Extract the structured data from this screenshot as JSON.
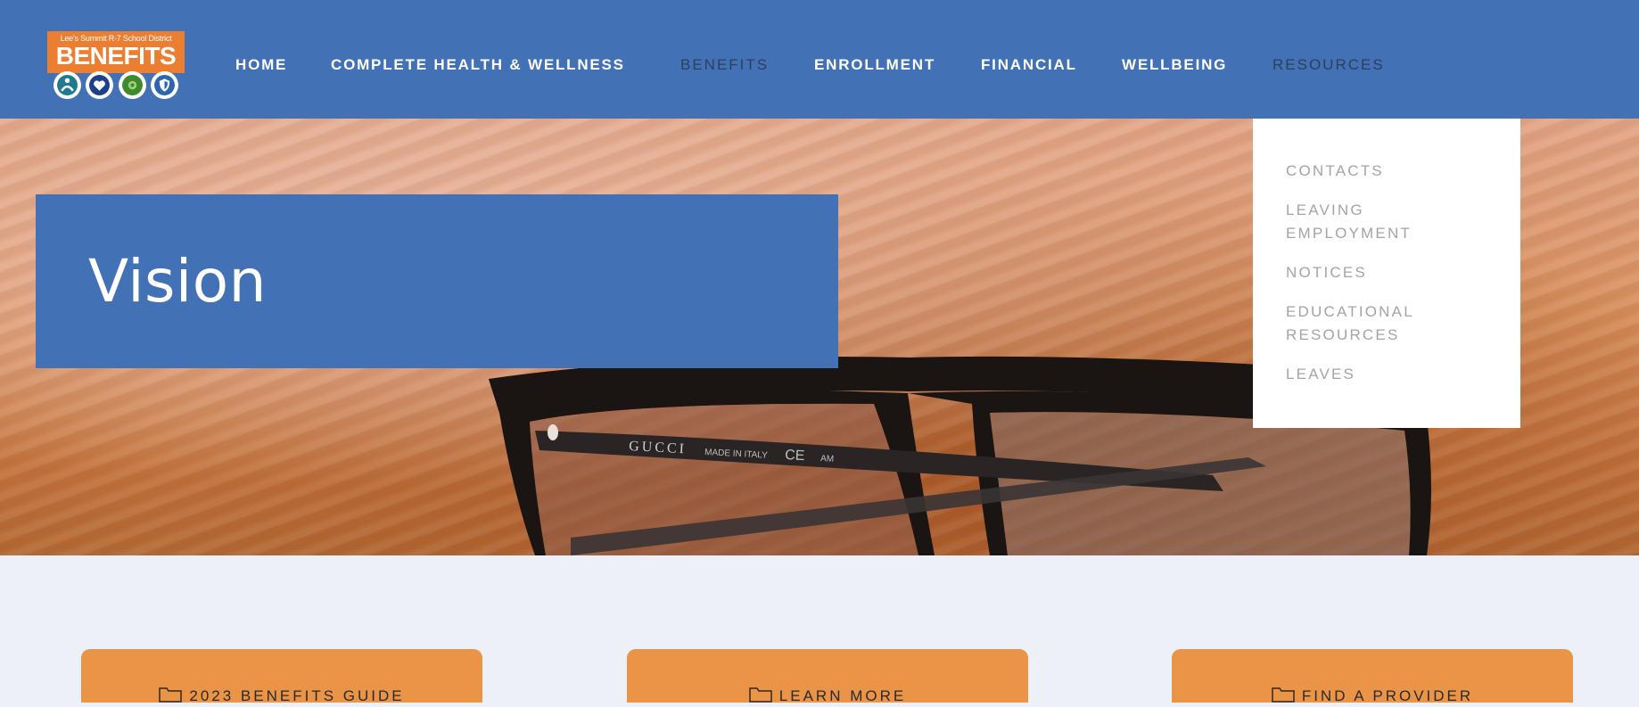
{
  "logo": {
    "district": "Lee's Summit R-7 School District",
    "wordmark": "BENEFITS",
    "icons": [
      "people-icon",
      "heart-icon",
      "leaf-icon",
      "shield-icon"
    ]
  },
  "nav": {
    "items": [
      {
        "label": "HOME"
      },
      {
        "label": "COMPLETE HEALTH & WELLNESS"
      },
      {
        "label": "BENEFITS"
      },
      {
        "label": "ENROLLMENT"
      },
      {
        "label": "FINANCIAL"
      },
      {
        "label": "WELLBEING"
      },
      {
        "label": "RESOURCES"
      }
    ]
  },
  "hero": {
    "title": "Vision",
    "image": "eyeglasses-on-wooden-table"
  },
  "dropdown": {
    "items": [
      {
        "label": "CONTACTS"
      },
      {
        "label": "LEAVING EMPLOYMENT"
      },
      {
        "label": "NOTICES"
      },
      {
        "label": "EDUCATIONAL RESOURCES"
      },
      {
        "label": "LEAVES"
      }
    ]
  },
  "cards": [
    {
      "label": "2023 BENEFITS GUIDE",
      "icon": "folder-icon"
    },
    {
      "label": "LEARN MORE",
      "icon": "folder-icon"
    },
    {
      "label": "FIND A PROVIDER",
      "icon": "folder-icon"
    }
  ],
  "colors": {
    "brand_blue": "#4271b6",
    "accent_orange": "#e99447",
    "logo_orange": "#ec7e32",
    "page_bg": "#edf1f7"
  }
}
